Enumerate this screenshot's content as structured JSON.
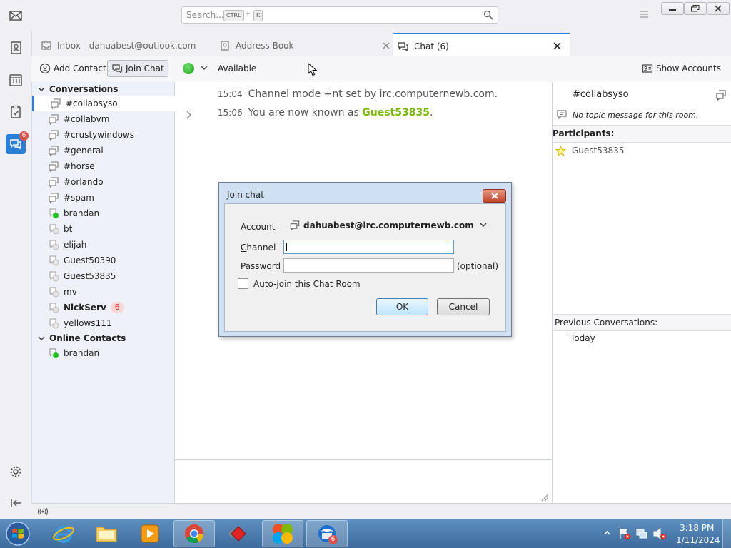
{
  "search": {
    "placeholder": "Search...",
    "key1": "CTRL",
    "plus": "+",
    "key2": "K"
  },
  "spaces": {
    "chat_badge": "6"
  },
  "tabs": [
    {
      "label": "Inbox - dahuabest@outlook.com"
    },
    {
      "label": "Address Book"
    },
    {
      "label": "Chat (6)"
    }
  ],
  "toolbar": {
    "add_contact": "Add Contact",
    "join_chat": "Join Chat",
    "status": "Available",
    "show_accounts": "Show Accounts"
  },
  "left": {
    "conversations_header": "Conversations",
    "conversations": [
      {
        "label": "#collabsyso"
      },
      {
        "label": "#collabvm"
      },
      {
        "label": "#crustywindows"
      },
      {
        "label": "#general"
      },
      {
        "label": "#horse"
      },
      {
        "label": "#orlando"
      },
      {
        "label": "#spam"
      },
      {
        "label": "brandan"
      },
      {
        "label": "bt"
      },
      {
        "label": "elijah"
      },
      {
        "label": "Guest50390"
      },
      {
        "label": "Guest53835"
      },
      {
        "label": "mv"
      },
      {
        "label": "NickServ",
        "badge": "6"
      },
      {
        "label": "yellows111"
      }
    ],
    "online_header": "Online Contacts",
    "online": [
      {
        "label": "brandan"
      }
    ]
  },
  "messages": [
    {
      "time": "15:04",
      "text": "Channel mode +nt set by irc.computernewb.com."
    },
    {
      "time": "15:06",
      "text": "You are now known as ",
      "nick": "Guest53835",
      "suffix": "."
    }
  ],
  "right": {
    "room": "#collabsyso",
    "topic": "No topic message for this room.",
    "participants_label": "Participants:",
    "participants_count": "1",
    "participants": [
      "Guest53835"
    ],
    "previous_label": "Previous Conversations:",
    "today": "Today"
  },
  "dialog": {
    "title": "Join chat",
    "account_label": "Account",
    "account_value": "dahuabest@irc.computernewb.com",
    "channel_label_u": "C",
    "channel_label_rest": "hannel",
    "channel_value": "",
    "password_label_u": "P",
    "password_label_rest": "assword",
    "optional": "(optional)",
    "autojoin_u": "A",
    "autojoin_rest": "uto-join this Chat Room",
    "ok": "OK",
    "cancel": "Cancel"
  },
  "taskbar": {
    "time": "3:18 PM",
    "date": "1/11/2024",
    "thunderbird_badge": "6"
  },
  "colors": {
    "accent": "#2a7fd4",
    "nick": "#7ab800",
    "online": "#22c422",
    "badge_bg": "#f8d7d7",
    "badge_fg": "#c0392b"
  }
}
